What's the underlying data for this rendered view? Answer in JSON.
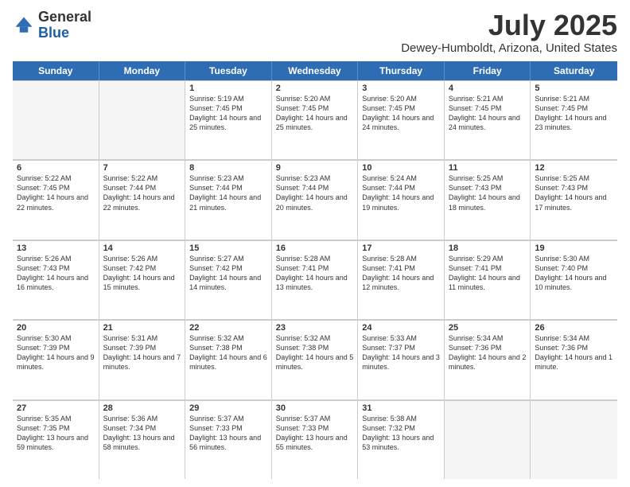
{
  "logo": {
    "general": "General",
    "blue": "Blue"
  },
  "title": "July 2025",
  "subtitle": "Dewey-Humboldt, Arizona, United States",
  "days_of_week": [
    "Sunday",
    "Monday",
    "Tuesday",
    "Wednesday",
    "Thursday",
    "Friday",
    "Saturday"
  ],
  "weeks": [
    [
      {
        "day": "",
        "content": ""
      },
      {
        "day": "",
        "content": ""
      },
      {
        "day": "1",
        "content": "Sunrise: 5:19 AM\nSunset: 7:45 PM\nDaylight: 14 hours and 25 minutes."
      },
      {
        "day": "2",
        "content": "Sunrise: 5:20 AM\nSunset: 7:45 PM\nDaylight: 14 hours and 25 minutes."
      },
      {
        "day": "3",
        "content": "Sunrise: 5:20 AM\nSunset: 7:45 PM\nDaylight: 14 hours and 24 minutes."
      },
      {
        "day": "4",
        "content": "Sunrise: 5:21 AM\nSunset: 7:45 PM\nDaylight: 14 hours and 24 minutes."
      },
      {
        "day": "5",
        "content": "Sunrise: 5:21 AM\nSunset: 7:45 PM\nDaylight: 14 hours and 23 minutes."
      }
    ],
    [
      {
        "day": "6",
        "content": "Sunrise: 5:22 AM\nSunset: 7:45 PM\nDaylight: 14 hours and 22 minutes."
      },
      {
        "day": "7",
        "content": "Sunrise: 5:22 AM\nSunset: 7:44 PM\nDaylight: 14 hours and 22 minutes."
      },
      {
        "day": "8",
        "content": "Sunrise: 5:23 AM\nSunset: 7:44 PM\nDaylight: 14 hours and 21 minutes."
      },
      {
        "day": "9",
        "content": "Sunrise: 5:23 AM\nSunset: 7:44 PM\nDaylight: 14 hours and 20 minutes."
      },
      {
        "day": "10",
        "content": "Sunrise: 5:24 AM\nSunset: 7:44 PM\nDaylight: 14 hours and 19 minutes."
      },
      {
        "day": "11",
        "content": "Sunrise: 5:25 AM\nSunset: 7:43 PM\nDaylight: 14 hours and 18 minutes."
      },
      {
        "day": "12",
        "content": "Sunrise: 5:25 AM\nSunset: 7:43 PM\nDaylight: 14 hours and 17 minutes."
      }
    ],
    [
      {
        "day": "13",
        "content": "Sunrise: 5:26 AM\nSunset: 7:43 PM\nDaylight: 14 hours and 16 minutes."
      },
      {
        "day": "14",
        "content": "Sunrise: 5:26 AM\nSunset: 7:42 PM\nDaylight: 14 hours and 15 minutes."
      },
      {
        "day": "15",
        "content": "Sunrise: 5:27 AM\nSunset: 7:42 PM\nDaylight: 14 hours and 14 minutes."
      },
      {
        "day": "16",
        "content": "Sunrise: 5:28 AM\nSunset: 7:41 PM\nDaylight: 14 hours and 13 minutes."
      },
      {
        "day": "17",
        "content": "Sunrise: 5:28 AM\nSunset: 7:41 PM\nDaylight: 14 hours and 12 minutes."
      },
      {
        "day": "18",
        "content": "Sunrise: 5:29 AM\nSunset: 7:41 PM\nDaylight: 14 hours and 11 minutes."
      },
      {
        "day": "19",
        "content": "Sunrise: 5:30 AM\nSunset: 7:40 PM\nDaylight: 14 hours and 10 minutes."
      }
    ],
    [
      {
        "day": "20",
        "content": "Sunrise: 5:30 AM\nSunset: 7:39 PM\nDaylight: 14 hours and 9 minutes."
      },
      {
        "day": "21",
        "content": "Sunrise: 5:31 AM\nSunset: 7:39 PM\nDaylight: 14 hours and 7 minutes."
      },
      {
        "day": "22",
        "content": "Sunrise: 5:32 AM\nSunset: 7:38 PM\nDaylight: 14 hours and 6 minutes."
      },
      {
        "day": "23",
        "content": "Sunrise: 5:32 AM\nSunset: 7:38 PM\nDaylight: 14 hours and 5 minutes."
      },
      {
        "day": "24",
        "content": "Sunrise: 5:33 AM\nSunset: 7:37 PM\nDaylight: 14 hours and 3 minutes."
      },
      {
        "day": "25",
        "content": "Sunrise: 5:34 AM\nSunset: 7:36 PM\nDaylight: 14 hours and 2 minutes."
      },
      {
        "day": "26",
        "content": "Sunrise: 5:34 AM\nSunset: 7:36 PM\nDaylight: 14 hours and 1 minute."
      }
    ],
    [
      {
        "day": "27",
        "content": "Sunrise: 5:35 AM\nSunset: 7:35 PM\nDaylight: 13 hours and 59 minutes."
      },
      {
        "day": "28",
        "content": "Sunrise: 5:36 AM\nSunset: 7:34 PM\nDaylight: 13 hours and 58 minutes."
      },
      {
        "day": "29",
        "content": "Sunrise: 5:37 AM\nSunset: 7:33 PM\nDaylight: 13 hours and 56 minutes."
      },
      {
        "day": "30",
        "content": "Sunrise: 5:37 AM\nSunset: 7:33 PM\nDaylight: 13 hours and 55 minutes."
      },
      {
        "day": "31",
        "content": "Sunrise: 5:38 AM\nSunset: 7:32 PM\nDaylight: 13 hours and 53 minutes."
      },
      {
        "day": "",
        "content": ""
      },
      {
        "day": "",
        "content": ""
      }
    ]
  ]
}
